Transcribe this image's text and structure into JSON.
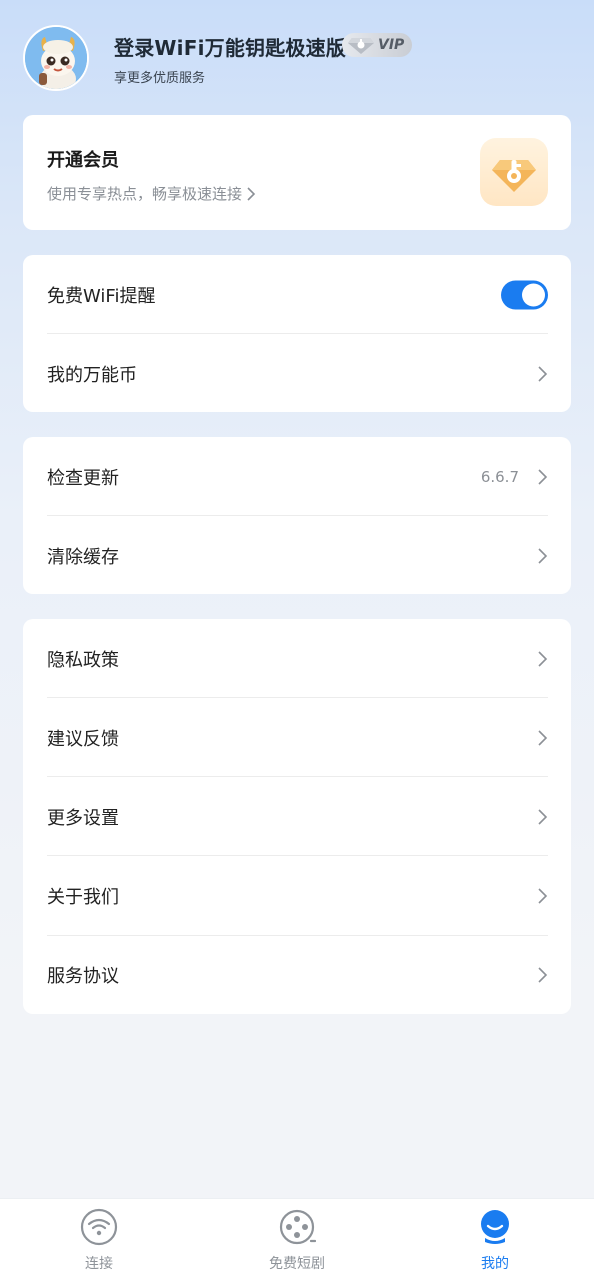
{
  "header": {
    "login_title": "登录WiFi万能钥匙极速版",
    "vip_label": "VIP",
    "subtitle": "享更多优质服务"
  },
  "member": {
    "title": "开通会员",
    "subtitle": "使用专享热点，畅享极速连接"
  },
  "group1": {
    "free_wifi_reminder": "免费WiFi提醒",
    "free_wifi_reminder_on": true,
    "coins": "我的万能币"
  },
  "group2": {
    "check_update": "检查更新",
    "version": "6.6.7",
    "clear_cache": "清除缓存"
  },
  "group3": {
    "privacy": "隐私政策",
    "feedback": "建议反馈",
    "more_settings": "更多设置",
    "about": "关于我们",
    "service_agreement": "服务协议"
  },
  "bottom_nav": {
    "connect": "连接",
    "short_drama": "免费短剧",
    "mine": "我的"
  },
  "colors": {
    "accent": "#1a7cf0",
    "member_gold": "#f4b55a"
  }
}
